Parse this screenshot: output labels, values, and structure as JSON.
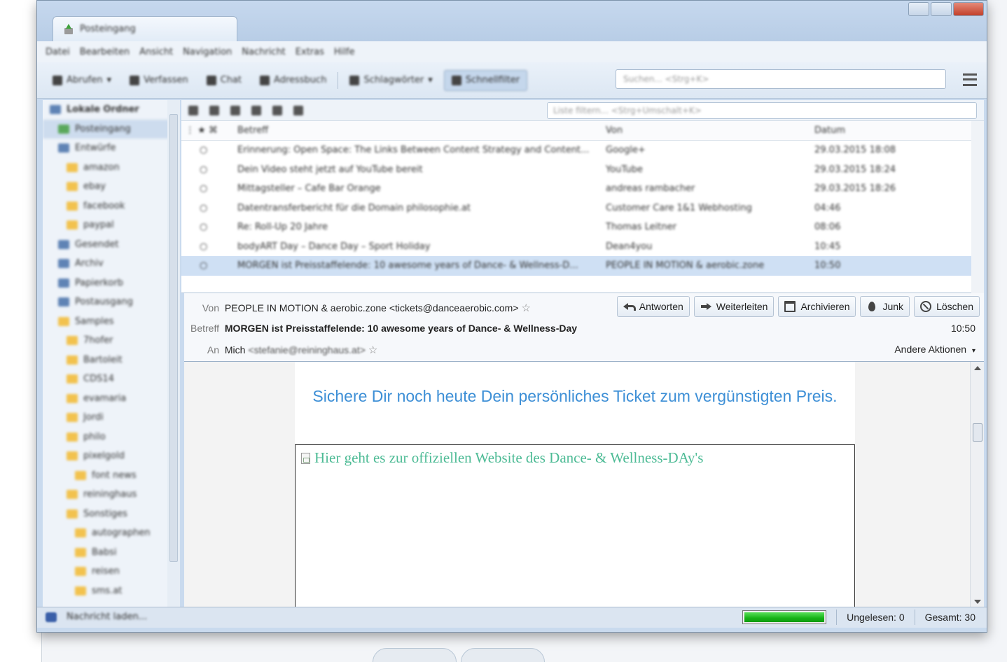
{
  "window": {
    "tab_title": "Posteingang",
    "menu": [
      "Datei",
      "Bearbeiten",
      "Ansicht",
      "Navigation",
      "Nachricht",
      "Extras",
      "Hilfe"
    ]
  },
  "toolbar": {
    "buttons": [
      {
        "label": "Abrufen"
      },
      {
        "label": "Verfassen"
      },
      {
        "label": "Chat"
      },
      {
        "label": "Adressbuch"
      },
      {
        "label": "Schlagwörter"
      },
      {
        "label": "Schnellfilter"
      }
    ],
    "search_placeholder": "Suchen... <Strg+K>"
  },
  "folders": [
    {
      "label": "Lokale Ordner",
      "level": 0,
      "icon": "folder-group-icon",
      "bold": true
    },
    {
      "label": "Posteingang",
      "level": 1,
      "icon": "inbox-icon",
      "selected": true
    },
    {
      "label": "Entwürfe",
      "level": 1,
      "icon": "drafts-icon"
    },
    {
      "label": "amazon",
      "level": 2,
      "icon": "folder-icon"
    },
    {
      "label": "ebay",
      "level": 2,
      "icon": "folder-icon"
    },
    {
      "label": "facebook",
      "level": 2,
      "icon": "folder-icon"
    },
    {
      "label": "paypal",
      "level": 2,
      "icon": "folder-icon"
    },
    {
      "label": "Gesendet",
      "level": 1,
      "icon": "sent-icon"
    },
    {
      "label": "Archiv",
      "level": 1,
      "icon": "archive-icon"
    },
    {
      "label": "Papierkorb",
      "level": 1,
      "icon": "trash-icon"
    },
    {
      "label": "Postausgang",
      "level": 1,
      "icon": "outbox-icon"
    },
    {
      "label": "Samples",
      "level": 1,
      "icon": "folder-icon"
    },
    {
      "label": "7hofer",
      "level": 2,
      "icon": "folder-icon"
    },
    {
      "label": "Bartoleit",
      "level": 2,
      "icon": "folder-icon"
    },
    {
      "label": "CDS14",
      "level": 2,
      "icon": "folder-icon"
    },
    {
      "label": "evamaria",
      "level": 2,
      "icon": "folder-icon"
    },
    {
      "label": "Jordi",
      "level": 2,
      "icon": "folder-icon"
    },
    {
      "label": "philo",
      "level": 2,
      "icon": "folder-icon"
    },
    {
      "label": "pixelgold",
      "level": 2,
      "icon": "folder-icon"
    },
    {
      "label": "font news",
      "level": 3,
      "icon": "folder-icon"
    },
    {
      "label": "reininghaus",
      "level": 2,
      "icon": "folder-icon"
    },
    {
      "label": "Sonstiges",
      "level": 2,
      "icon": "folder-icon"
    },
    {
      "label": "autographen",
      "level": 3,
      "icon": "folder-icon"
    },
    {
      "label": "Babsi",
      "level": 3,
      "icon": "folder-icon"
    },
    {
      "label": "reisen",
      "level": 3,
      "icon": "folder-icon"
    },
    {
      "label": "sms.at",
      "level": 3,
      "icon": "folder-icon"
    }
  ],
  "list": {
    "filter_placeholder": "Liste filtern... <Strg+Umschalt+K>",
    "columns": {
      "subject": "Betreff",
      "from": "Von",
      "date": "Datum"
    },
    "rows": [
      {
        "subject": "Erinnerung: Open Space: The Links Between Content Strategy and Content...",
        "from": "Google+",
        "date": "29.03.2015 18:08",
        "selected": false
      },
      {
        "subject": "Dein Video steht jetzt auf YouTube bereit",
        "from": "YouTube",
        "date": "29.03.2015 18:24",
        "selected": false
      },
      {
        "subject": "Mittagsteller – Cafe Bar Orange",
        "from": "andreas rambacher",
        "date": "29.03.2015 18:26",
        "selected": false
      },
      {
        "subject": "Datentransferbericht für die Domain philosophie.at",
        "from": "Customer Care 1&1 Webhosting",
        "date": "04:46",
        "selected": false
      },
      {
        "subject": "Re: Roll-Up 20 Jahre",
        "from": "Thomas Leitner",
        "date": "08:06",
        "selected": false
      },
      {
        "subject": "bodyART Day – Dance Day – Sport Holiday",
        "from": "Dean4you",
        "date": "10:45",
        "selected": false
      },
      {
        "subject": "MORGEN ist Preisstaffelende: 10 awesome years of Dance- & Wellness-D...",
        "from": "PEOPLE IN MOTION & aerobic.zone",
        "date": "10:50",
        "selected": true
      }
    ]
  },
  "header": {
    "from_label": "Von",
    "from_value": "PEOPLE IN MOTION & aerobic.zone <tickets@danceaerobic.com>",
    "subject_label": "Betreff",
    "subject_value": "MORGEN ist Preisstaffelende: 10 awesome years of Dance- & Wellness-Day",
    "to_label": "An",
    "to_name": "Mich",
    "to_address": "<stefanie@reininghaus.at>",
    "time": "10:50",
    "other_actions": "Andere Aktionen",
    "actions": {
      "reply": "Antworten",
      "forward": "Weiterleiten",
      "archive": "Archivieren",
      "junk": "Junk",
      "delete": "Löschen"
    }
  },
  "body": {
    "heading": "Sichere Dir noch heute Dein persönliches Ticket zum vergünstigten Preis.",
    "link_text": "Hier geht es zur offiziellen Website des Dance- & Wellness-DAy's"
  },
  "status": {
    "message": "Nachricht laden...",
    "progress": 1.0,
    "unread": "Ungelesen: 0",
    "total": "Gesamt: 30"
  },
  "colors": {
    "heading_blue": "#3d8fd6",
    "link_green": "#4dbb95",
    "progress_green": "#15b315",
    "selection": "#cfe0f4"
  }
}
